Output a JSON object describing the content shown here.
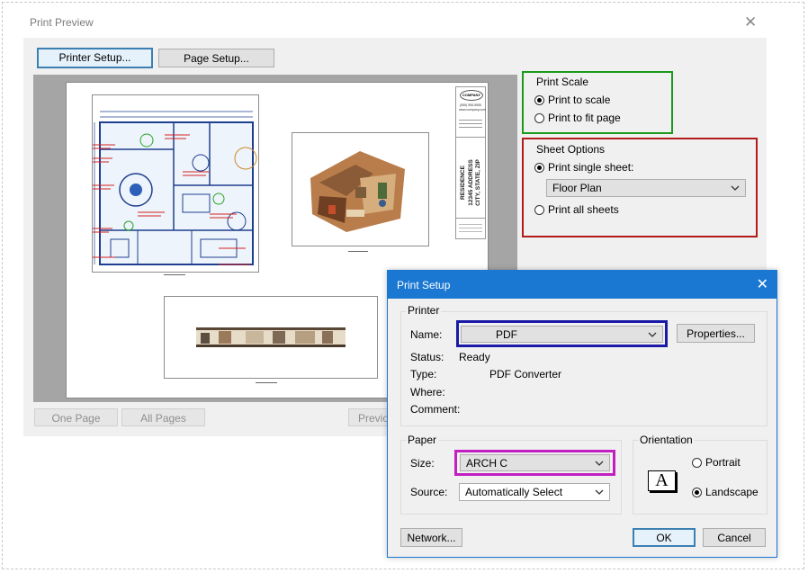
{
  "print_preview": {
    "title": "Print Preview",
    "close_glyph": "✕",
    "printer_setup_label": "Printer Setup...",
    "page_setup_label": "Page Setup...",
    "one_page_label": "One Page",
    "all_pages_label": "All Pages",
    "previous_label": "Previo",
    "print_scale": {
      "title": "Print Scale",
      "options": [
        "Print to scale",
        "Print to fit page"
      ],
      "selected": 0
    },
    "sheet_options": {
      "title": "Sheet Options",
      "options": [
        "Print single sheet:",
        "Print all sheets"
      ],
      "selected": 0,
      "sheet_value": "Floor Plan"
    },
    "title_block": {
      "logo": "COMPANY",
      "info": "(555) 555-5555\nwww.company.com",
      "project_line1": "RESIDENCE",
      "project_line2": "12345 ADDRESS\nCITY, STATE, ZIP"
    }
  },
  "print_setup": {
    "title": "Print Setup",
    "close_glyph": "✕",
    "printer_group": "Printer",
    "name_label": "Name:",
    "name_value": "PDF",
    "properties_label": "Properties...",
    "status_label": "Status:",
    "status_value": "Ready",
    "type_label": "Type:",
    "type_value": "PDF Converter",
    "where_label": "Where:",
    "comment_label": "Comment:",
    "paper_group": "Paper",
    "size_label": "Size:",
    "size_value": "ARCH C",
    "source_label": "Source:",
    "source_value": "Automatically Select",
    "orientation_group": "Orientation",
    "orientation_glyph": "A",
    "portrait_label": "Portrait",
    "landscape_label": "Landscape",
    "network_label": "Network...",
    "ok_label": "OK",
    "cancel_label": "Cancel"
  },
  "colors": {
    "print_scale_highlight": "#1b9a1b",
    "sheet_options_highlight": "#b31b1b",
    "printer_name_highlight": "#1a1aa6",
    "paper_size_highlight": "#c21fc2",
    "titlebar": "#1a78d2"
  }
}
